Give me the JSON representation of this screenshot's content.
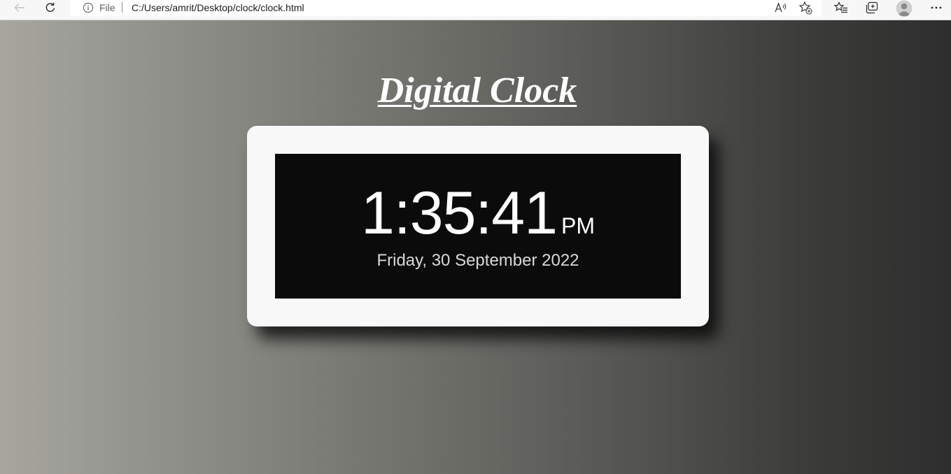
{
  "browser": {
    "address_bar": {
      "scheme_label": "File",
      "url": "C:/Users/amrit/Desktop/clock/clock.html"
    },
    "icons": [
      "back-arrow-icon",
      "reload-icon",
      "info-icon",
      "read-aloud-icon",
      "add-favorite-icon",
      "favorites-icon",
      "collections-icon",
      "profile-icon",
      "more-icon"
    ]
  },
  "page": {
    "title": "Digital Clock",
    "background_colors": [
      "#a6a69f",
      "#2e2e2e"
    ],
    "clock": {
      "time": "1:35:41",
      "period": "PM",
      "date": "Friday, 30 September 2022",
      "card_color": "#f8f8f9",
      "screen_color": "#0b0b0b"
    }
  }
}
